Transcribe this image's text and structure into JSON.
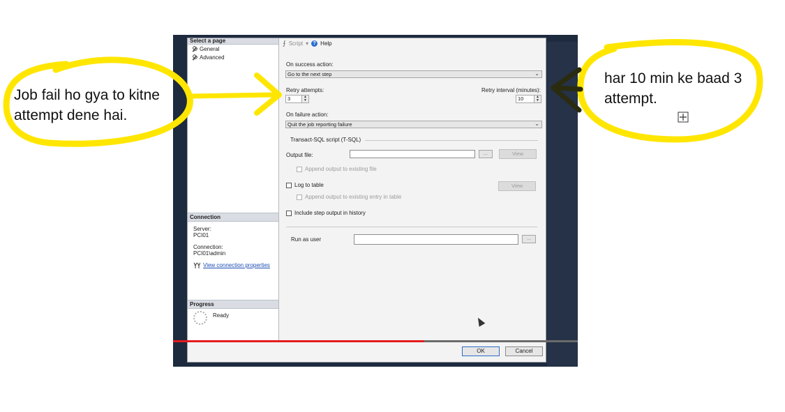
{
  "annotations": {
    "left_note": "Job fail ho gya to kitne attempt dene hai.",
    "right_note": "har 10 min ke baad 3 attempt."
  },
  "dialog": {
    "left_pane": {
      "select_page_header": "Select a page",
      "pages": [
        {
          "label": "General"
        },
        {
          "label": "Advanced"
        }
      ],
      "connection_header": "Connection",
      "server_label": "Server:",
      "server_value": "PCI01",
      "connection_label": "Connection:",
      "connection_value": "PCI01\\admin",
      "view_connection_link": "View connection properties",
      "progress_header": "Progress",
      "progress_status": "Ready"
    },
    "toolbar": {
      "script_label": "Script",
      "help_label": "Help"
    },
    "on_success": {
      "label": "On success action:",
      "value": "Go to the next step"
    },
    "retry_attempts": {
      "label": "Retry attempts:",
      "value": "3"
    },
    "retry_interval": {
      "label": "Retry interval (minutes):",
      "value": "10"
    },
    "on_failure": {
      "label": "On failure action:",
      "value": "Quit the job reporting failure"
    },
    "tsql_group_label": "Transact-SQL script (T-SQL)",
    "output_file": {
      "label": "Output file:",
      "value": "",
      "browse_label": "...",
      "view_label": "View"
    },
    "append_output_label": "Append output to existing file",
    "log_to_table": {
      "label": "Log to table",
      "view_label": "View"
    },
    "append_table_label": "Append output to existing entry in table",
    "include_history_label": "Include step output in history",
    "run_as_user": {
      "label": "Run as user",
      "value": "",
      "browse_label": "..."
    },
    "ok_label": "OK",
    "cancel_label": "Cancel"
  },
  "video_progress": 0.62,
  "colors": {
    "highlight_yellow": "#ffe600",
    "arrow_dark": "#2b2b10",
    "progress_red": "#e51c1c",
    "video_bg": "#1e2a3e"
  }
}
